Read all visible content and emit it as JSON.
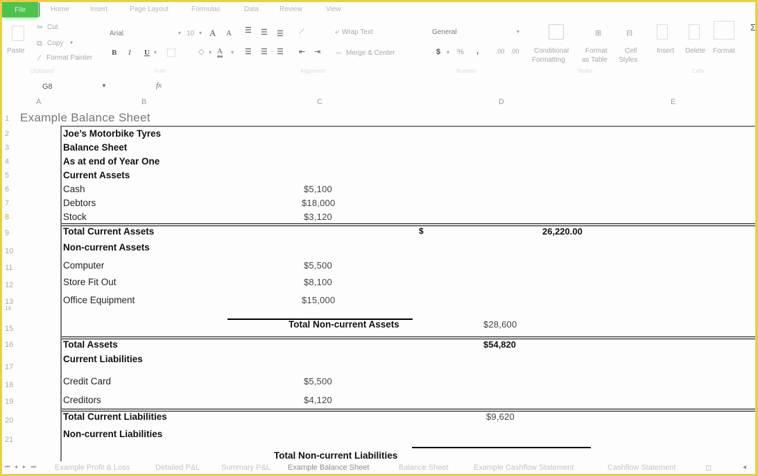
{
  "ribbon_tabs": {
    "file": "File",
    "items": [
      "Home",
      "Insert",
      "Page Layout",
      "Formulas",
      "Data",
      "Review",
      "View"
    ]
  },
  "clipboard": {
    "paste": "Paste",
    "cut": "Cut",
    "copy": "Copy",
    "format_painter": "Format Painter",
    "group_label": "Clipboard"
  },
  "font": {
    "family": "Arial",
    "size": "10",
    "grow": "A",
    "shrink": "A",
    "bold": "B",
    "italic": "I",
    "underline": "U",
    "font_color_glyph": "A",
    "group_label": "Font"
  },
  "alignment": {
    "wrap_text": "Wrap Text",
    "merge_center": "Merge & Center",
    "group_label": "Alignment"
  },
  "number": {
    "format": "General",
    "currency": "$",
    "percent": "%",
    "comma": ",",
    "inc_decimal": ".00",
    "dec_decimal": ".00",
    "group_label": "Number"
  },
  "styles": {
    "conditional_1": "Conditional",
    "conditional_2": "Formatting",
    "format_table_1": "Format",
    "format_table_2": "as Table",
    "cell_styles_1": "Cell",
    "cell_styles_2": "Styles",
    "group_label": "Styles"
  },
  "cells": {
    "insert": "Insert",
    "delete": "Delete",
    "format": "Format",
    "group_label": "Cells"
  },
  "editing": {
    "autosum": "Σ"
  },
  "formula_bar": {
    "name_box": "G8",
    "fx": "fx",
    "formula": ""
  },
  "columns": [
    "A",
    "B",
    "C",
    "D",
    "E"
  ],
  "rows": [
    "1",
    "2",
    "3",
    "4",
    "5",
    "6",
    "7",
    "8",
    "9",
    "10",
    "11",
    "12",
    "13",
    "14",
    "15",
    "16",
    "17",
    "18",
    "19",
    "20",
    "21"
  ],
  "sheet": {
    "title": "Example Balance Sheet",
    "company": "Joe’s Motorbike Tyres",
    "doc_title": "Balance Sheet",
    "period": "As at end of Year One",
    "current_assets": {
      "heading": "Current Assets",
      "items": [
        {
          "label": "Cash",
          "value": "$5,100"
        },
        {
          "label": "Debtors",
          "value": "$18,000"
        },
        {
          "label": "Stock",
          "value": "$3,120"
        }
      ],
      "total_label": "Total Current Assets",
      "total_currency": "$",
      "total_value": "26,220.00"
    },
    "non_current_assets": {
      "heading": "Non-current Assets",
      "items": [
        {
          "label": "Computer",
          "value": "$5,500"
        },
        {
          "label": "Store Fit Out",
          "value": "$8,100"
        },
        {
          "label": "Office Equipment",
          "value": "$15,000"
        }
      ],
      "total_label": "Total Non-current Assets",
      "total_value": "$28,600"
    },
    "total_assets": {
      "label": "Total Assets",
      "value": "$54,820"
    },
    "current_liabilities": {
      "heading": "Current Liabilities",
      "items": [
        {
          "label": "Credit Card",
          "value": "$5,500"
        },
        {
          "label": "Creditors",
          "value": "$4,120"
        }
      ],
      "total_label": "Total Current Liabilities",
      "total_value": "$9,620"
    },
    "non_current_liabilities": {
      "heading": "Non-current Liabilities",
      "total_label": "Total Non-current Liabilities"
    }
  },
  "sheet_tabs": {
    "items": [
      "Example Profit & Loss",
      "Detailed P&L",
      "Summary P&L",
      "Example Balance Sheet",
      "Balance Sheet",
      "Example Cashflow Statement",
      "Cashflow Statement"
    ],
    "active": "Example Balance Sheet"
  }
}
